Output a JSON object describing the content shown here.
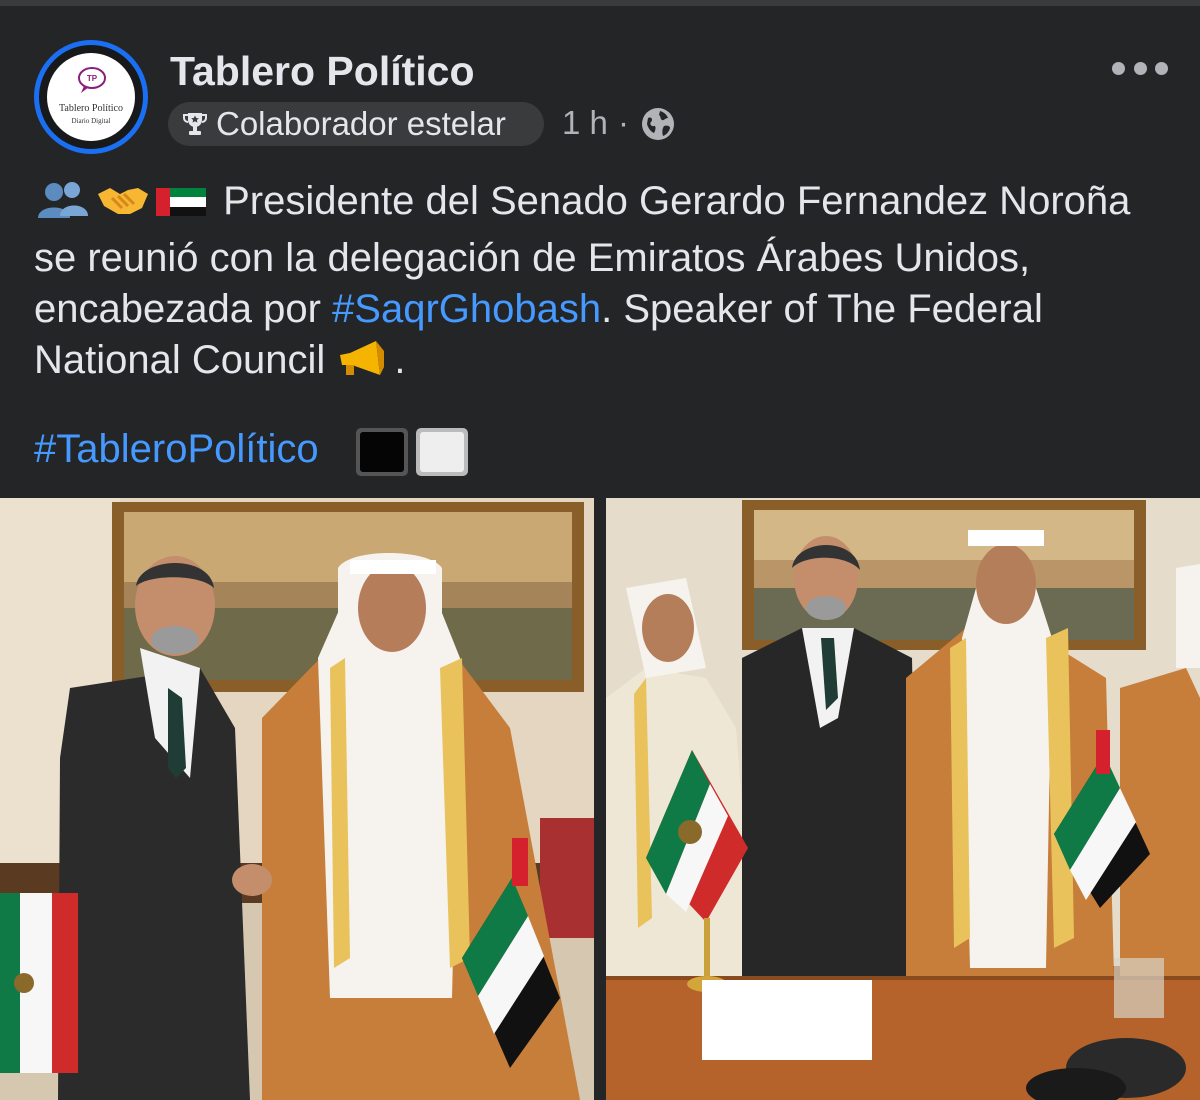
{
  "post": {
    "page_name": "Tablero Político",
    "avatar": {
      "logo_letters": "TP",
      "name": "Tablero Político",
      "subtitle": "Diario Digital"
    },
    "badge_label": "Colaborador estelar",
    "time": "1 h",
    "separator": "·",
    "icons": {
      "trophy": "trophy-icon",
      "audience": "globe-icon",
      "more": "more-options-icon"
    },
    "text_emojis": [
      "👥",
      "🤝",
      "🇦🇪"
    ],
    "text_part1": "Presidente del Senado Gerardo Fernandez Noroña se reunió con la delegación de Emiratos Árabes Unidos, encabezada por",
    "hashtag1": "#SaqrGhobash",
    "text_part2": ". Speaker of The Federal National Council",
    "megaphone_emoji": "📣",
    "text_end": ".",
    "hashtag2": "#TableroPolítico",
    "trailing_emojis": [
      "⬛",
      "⬜"
    ]
  },
  "photos": [
    {
      "name": "Handshake between Senate President and UAE delegate"
    },
    {
      "name": "Group photo with Mexican and UAE flags"
    }
  ]
}
